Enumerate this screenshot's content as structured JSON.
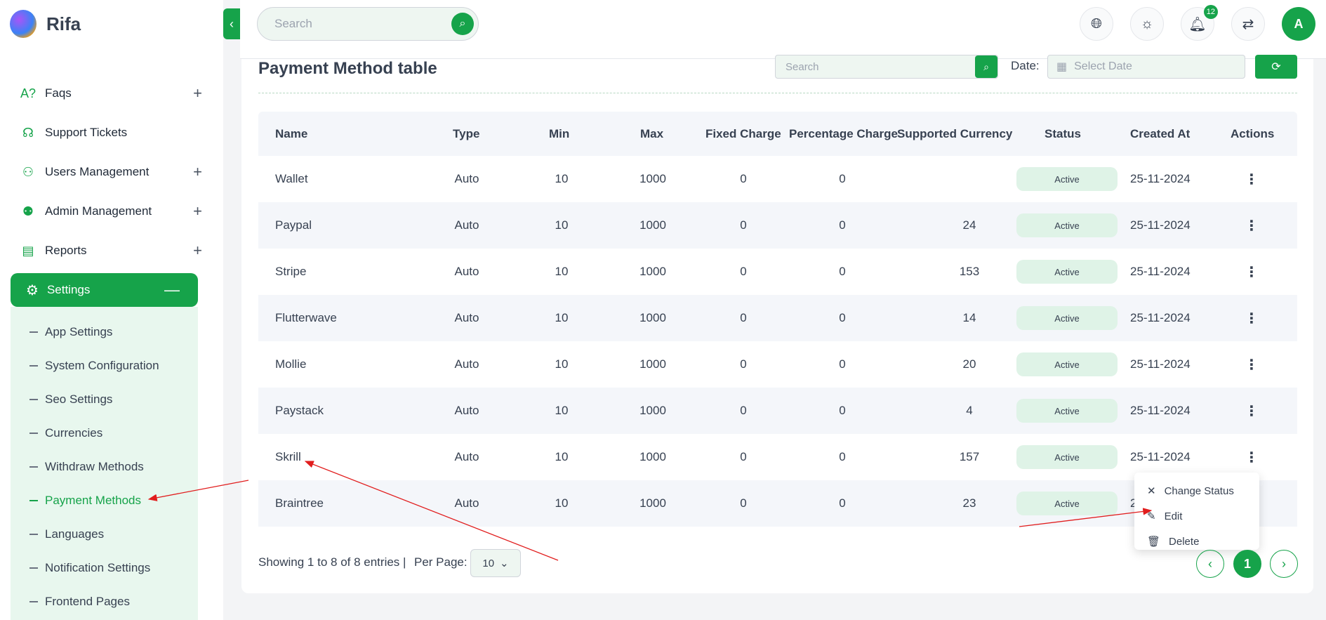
{
  "brand": {
    "name": "Rifa"
  },
  "sidebar": {
    "items": [
      {
        "label": "Faqs",
        "icon": "faq-icon",
        "expandable": true
      },
      {
        "label": "Support Tickets",
        "icon": "support-icon",
        "expandable": false
      },
      {
        "label": "Users Management",
        "icon": "users-icon",
        "expandable": true
      },
      {
        "label": "Admin Management",
        "icon": "admin-icon",
        "expandable": true
      },
      {
        "label": "Reports",
        "icon": "reports-icon",
        "expandable": true
      }
    ],
    "active": {
      "label": "Settings",
      "icon": "gear-icon"
    },
    "submenu": [
      "App Settings",
      "System Configuration",
      "Seo Settings",
      "Currencies",
      "Withdraw Methods",
      "Payment Methods",
      "Languages",
      "Notification Settings",
      "Frontend Pages"
    ],
    "active_submenu": "Payment Methods"
  },
  "topbar": {
    "search_placeholder": "Search",
    "notification_count": "12",
    "avatar_initial": "A"
  },
  "page": {
    "title": "Payment Method table",
    "search_placeholder": "Search",
    "date_label": "Date:",
    "date_placeholder": "Select Date"
  },
  "table": {
    "headers": [
      "Name",
      "Type",
      "Min",
      "Max",
      "Fixed Charge",
      "Percentage Charge",
      "Supported Currency",
      "Status",
      "Created At",
      "Actions"
    ],
    "rows": [
      {
        "name": "Wallet",
        "type": "Auto",
        "min": "10",
        "max": "1000",
        "fixed": "0",
        "percent": "0",
        "currency": "",
        "status": "Active",
        "created": "25-11-2024"
      },
      {
        "name": "Paypal",
        "type": "Auto",
        "min": "10",
        "max": "1000",
        "fixed": "0",
        "percent": "0",
        "currency": "24",
        "status": "Active",
        "created": "25-11-2024"
      },
      {
        "name": "Stripe",
        "type": "Auto",
        "min": "10",
        "max": "1000",
        "fixed": "0",
        "percent": "0",
        "currency": "153",
        "status": "Active",
        "created": "25-11-2024"
      },
      {
        "name": "Flutterwave",
        "type": "Auto",
        "min": "10",
        "max": "1000",
        "fixed": "0",
        "percent": "0",
        "currency": "14",
        "status": "Active",
        "created": "25-11-2024"
      },
      {
        "name": "Mollie",
        "type": "Auto",
        "min": "10",
        "max": "1000",
        "fixed": "0",
        "percent": "0",
        "currency": "20",
        "status": "Active",
        "created": "25-11-2024"
      },
      {
        "name": "Paystack",
        "type": "Auto",
        "min": "10",
        "max": "1000",
        "fixed": "0",
        "percent": "0",
        "currency": "4",
        "status": "Active",
        "created": "25-11-2024"
      },
      {
        "name": "Skrill",
        "type": "Auto",
        "min": "10",
        "max": "1000",
        "fixed": "0",
        "percent": "0",
        "currency": "157",
        "status": "Active",
        "created": "25-11-2024"
      },
      {
        "name": "Braintree",
        "type": "Auto",
        "min": "10",
        "max": "1000",
        "fixed": "0",
        "percent": "0",
        "currency": "23",
        "status": "Active",
        "created": "2"
      }
    ]
  },
  "dropdown": {
    "items": [
      {
        "label": "Change Status",
        "icon": "close-icon"
      },
      {
        "label": "Edit",
        "icon": "pencil-icon"
      },
      {
        "label": "Delete",
        "icon": "trash-icon"
      }
    ]
  },
  "footer": {
    "showing": "Showing 1 to 8 of 8 entries |",
    "per_page_label": "Per Page:",
    "per_page_value": "10",
    "current_page": "1"
  },
  "colors": {
    "accent": "#16a34a",
    "annotation": "#e11d1d"
  }
}
